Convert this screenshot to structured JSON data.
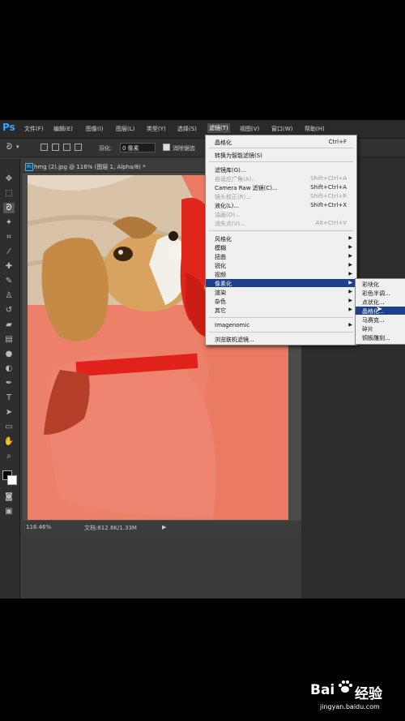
{
  "app": {
    "logo": "Ps"
  },
  "menubar": {
    "items": [
      {
        "label": "文件(F)"
      },
      {
        "label": "编辑(E)"
      },
      {
        "label": "图像(I)"
      },
      {
        "label": "图层(L)"
      },
      {
        "label": "类型(Y)"
      },
      {
        "label": "选择(S)"
      },
      {
        "label": "滤镜(T)"
      },
      {
        "label": "视图(V)"
      },
      {
        "label": "窗口(W)"
      },
      {
        "label": "帮助(H)"
      }
    ],
    "active_index": 6
  },
  "options": {
    "feather_label": "羽化:",
    "feather_value": "0 像素",
    "antialias_label": "消除锯齿"
  },
  "document": {
    "title": "hmg (2).jpg @ 116% (图层 1, Alpha/8) *",
    "status_zoom": "116.46%",
    "status_doc": "文档:612.8K/1.33M"
  },
  "filter_menu": {
    "items": [
      {
        "label": "晶格化",
        "shortcut": "Ctrl+F",
        "enabled": true
      },
      {
        "label": "转换为智能滤镜(S)",
        "enabled": true
      },
      {
        "label": "滤镜库(G)...",
        "enabled": true
      },
      {
        "label": "自适应广角(A)...",
        "shortcut": "Shift+Ctrl+A",
        "enabled": false
      },
      {
        "label": "Camera Raw 滤镜(C)...",
        "shortcut": "Shift+Ctrl+A",
        "enabled": true
      },
      {
        "label": "镜头校正(R)...",
        "shortcut": "Shift+Ctrl+R",
        "enabled": false
      },
      {
        "label": "液化(L)...",
        "shortcut": "Shift+Ctrl+X",
        "enabled": true
      },
      {
        "label": "油画(O)...",
        "enabled": false
      },
      {
        "label": "消失点(V)...",
        "shortcut": "Alt+Ctrl+V",
        "enabled": false
      },
      {
        "label": "风格化",
        "submenu": true,
        "enabled": true
      },
      {
        "label": "模糊",
        "submenu": true,
        "enabled": true
      },
      {
        "label": "扭曲",
        "submenu": true,
        "enabled": true
      },
      {
        "label": "锐化",
        "submenu": true,
        "enabled": true
      },
      {
        "label": "视频",
        "submenu": true,
        "enabled": true
      },
      {
        "label": "像素化",
        "submenu": true,
        "enabled": true,
        "highlighted": true
      },
      {
        "label": "渲染",
        "submenu": true,
        "enabled": true
      },
      {
        "label": "杂色",
        "submenu": true,
        "enabled": true
      },
      {
        "label": "其它",
        "submenu": true,
        "enabled": true
      },
      {
        "label": "Imagenomic",
        "submenu": true,
        "enabled": true
      },
      {
        "label": "浏览联机滤镜...",
        "enabled": true
      }
    ]
  },
  "pixelate_submenu": {
    "items": [
      {
        "label": "彩块化"
      },
      {
        "label": "彩色半调..."
      },
      {
        "label": "点状化..."
      },
      {
        "label": "晶格化...",
        "highlighted": true
      },
      {
        "label": "马赛克..."
      },
      {
        "label": "碎片"
      },
      {
        "label": "铜板雕刻..."
      }
    ]
  },
  "watermark": {
    "brand": "Bai",
    "brand2": "经验",
    "url": "jingyan.baidu.com"
  },
  "colors": {
    "selection": "#1e3f8a",
    "mask": "#ec8068",
    "accent": "#31a8ff"
  }
}
